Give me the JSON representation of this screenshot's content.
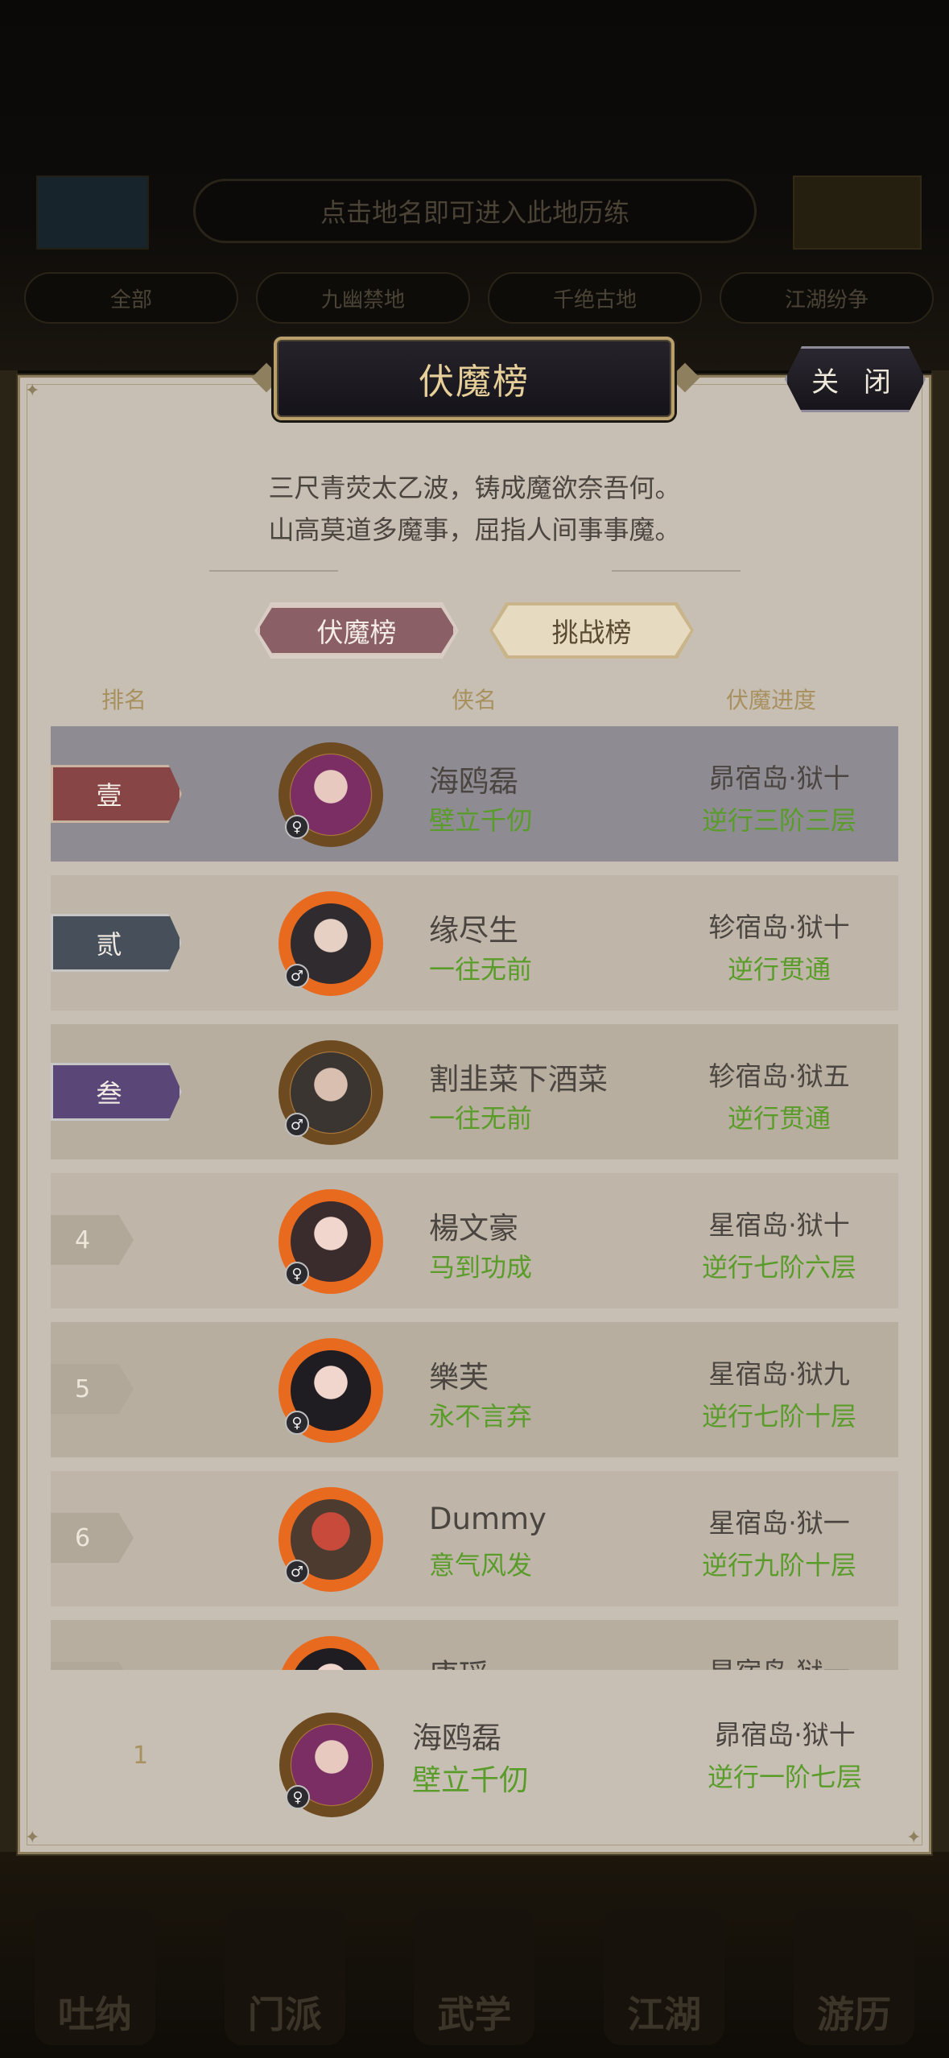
{
  "background": {
    "search_hint": "点击地名即可进入此地历练",
    "filters": [
      "全部",
      "九幽禁地",
      "千绝古地",
      "江湖纷争"
    ],
    "nav": [
      "吐纳",
      "门派",
      "武学",
      "江湖",
      "游历"
    ]
  },
  "dialog": {
    "title": "伏魔榜",
    "close_label": "关 闭",
    "poem_line1": "三尺青荧太乙波，铸成魔欲奈吾何。",
    "poem_line2": "山高莫道多魔事，屈指人间事事魔。",
    "tabs": [
      {
        "label": "伏魔榜",
        "active": true
      },
      {
        "label": "挑战榜",
        "active": false
      }
    ],
    "columns": {
      "rank": "排名",
      "name": "侠名",
      "progress": "伏魔进度"
    },
    "rows": [
      {
        "rank": "壹",
        "name": "海鸥磊",
        "motto": "壁立千仞",
        "location": "昴宿岛·狱十",
        "level": "逆行三阶三层",
        "gender": "♀"
      },
      {
        "rank": "贰",
        "name": "缘尽生",
        "motto": "一往无前",
        "location": "轸宿岛·狱十",
        "level": "逆行贯通",
        "gender": "♂"
      },
      {
        "rank": "叁",
        "name": "割韭菜下酒菜",
        "motto": "一往无前",
        "location": "轸宿岛·狱五",
        "level": "逆行贯通",
        "gender": "♂"
      },
      {
        "rank": "4",
        "name": "楊文豪",
        "motto": "马到功成",
        "location": "星宿岛·狱十",
        "level": "逆行七阶六层",
        "gender": "♀"
      },
      {
        "rank": "5",
        "name": "樂芙",
        "motto": "永不言弃",
        "location": "星宿岛·狱九",
        "level": "逆行七阶十层",
        "gender": "♀"
      },
      {
        "rank": "6",
        "name": "Dummy",
        "motto": "意气风发",
        "location": "星宿岛·狱一",
        "level": "逆行九阶十层",
        "gender": "♂"
      },
      {
        "rank": "",
        "name": "唐瑶",
        "motto": "",
        "location": "星宿岛·狱一",
        "level": "",
        "gender": "♀"
      }
    ],
    "my_rank": {
      "rank": "1",
      "name": "海鸥磊",
      "motto": "壁立千仞",
      "location": "昴宿岛·狱十",
      "level": "逆行一阶七层",
      "gender": "♀"
    },
    "colors": {
      "panel": "#c7bfb4",
      "row_first": "#8e8b92",
      "row_alt_light": "#bfb6a9",
      "row_alt_dark": "#b8ae9f",
      "rank1": "#874546",
      "rank2": "#47505a",
      "rank3": "#5a4778",
      "green": "#5a9c2a"
    }
  }
}
